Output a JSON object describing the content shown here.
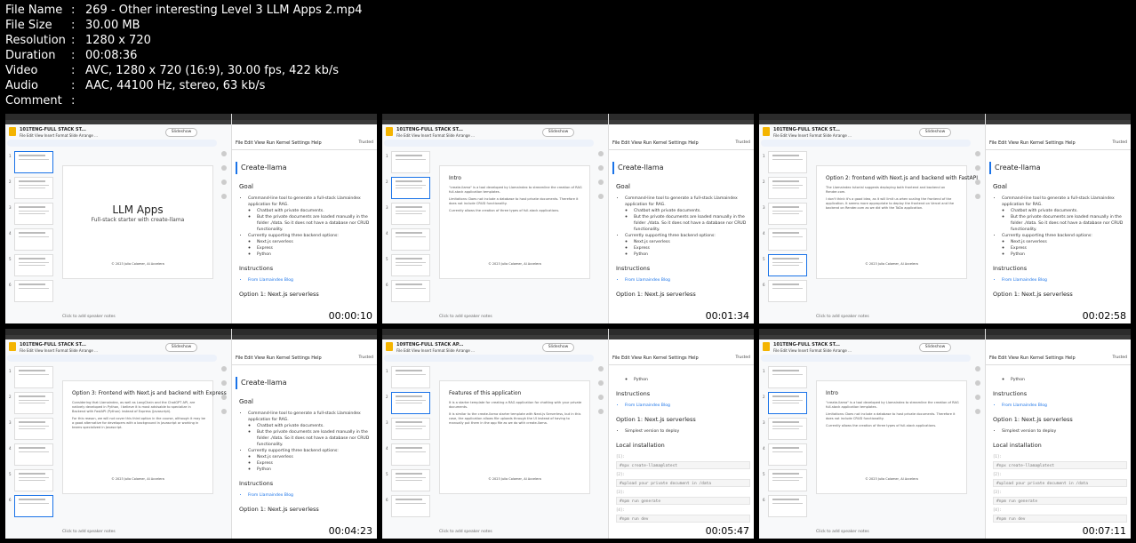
{
  "meta": [
    {
      "key": "File Name",
      "value": "269 - Other interesting Level 3 LLM Apps 2.mp4"
    },
    {
      "key": "File Size",
      "value": "30.00 MB"
    },
    {
      "key": "Resolution",
      "value": "1280 x 720"
    },
    {
      "key": "Duration",
      "value": "00:08:36"
    },
    {
      "key": "Video",
      "value": "AVC, 1280 x 720 (16:9), 30.00 fps, 422 kb/s"
    },
    {
      "key": "Audio",
      "value": "AAC, 44100 Hz, stereo, 63 kb/s"
    },
    {
      "key": "Comment",
      "value": ""
    }
  ],
  "separator": ":",
  "common": {
    "slides_menu": "File  Edit  View  Insert  Format  Slide  Arrange ...",
    "slideshow": "Slideshow",
    "notes": "Click to add speaker notes",
    "jup_menu": "File   Edit   View   Run   Kernel   Settings   Help",
    "trusted": "Trusted",
    "create_llama": "Create-llama",
    "goal": "Goal",
    "goal_text": "Command-line tool to generate a full-stack Llamaindex application for RAG.",
    "sub1": "Chatbot with private documents.",
    "sub2": "But the private documents are loaded manually in the folder ./data. So it does not have a database nor CRUD functionality.",
    "backends": "Currently supporting three backend options:",
    "b1": "Next.js serverless",
    "b2": "Express",
    "b3": "Python",
    "instructions": "Instructions",
    "from_blog": "From Llamaindex Blog",
    "option1": "Option 1: Next.js serverless",
    "simplest": "Simplest version to deploy",
    "local_install": "Local installation",
    "cmd1": "#npx create-llama@latest",
    "cmd2": "#upload your private document in /data",
    "cmd3": "#npm run generate",
    "cmd4": "#npm run dev",
    "prompt1": "[1]:",
    "prompt2": "[2]:",
    "prompt3": "[3]:",
    "prompt4": "[4]:",
    "copyright": "© 2023 Julio Colomer, AI Accelera"
  },
  "tiles": [
    {
      "doc_title": "101TENG-FULL STACK ST...",
      "slide_title": "LLM Apps",
      "slide_sub": "Full-stack starter with create-llama",
      "timestamp": "00:00:10"
    },
    {
      "doc_title": "101TENG-FULL STACK ST...",
      "slide_heading": "Intro",
      "slide_body": [
        "\"create-llama\" is a tool developed by Llamaindex to streamline the creation of RAG full-stack application templates.",
        "Limitations: Does not include a database to host private documents. Therefore it does not include CRUD functionality.",
        "Currently allows the creation of three types of full-stack applications."
      ],
      "timestamp": "00:01:34"
    },
    {
      "doc_title": "101TENG-FULL STACK ST...",
      "slide_heading": "Option 2: frontend with Next.js and backend with FastAPI",
      "slide_body": [
        "The Llamaindex tutorial suggests deploying both frontend and backend on Render.com.",
        "I don't think it's a good idea, as it will limit us when scaling the frontend of the application. It seems more appropriate to deploy the frontend on Vercel and the backend on Render.com as we did with the ToDo application."
      ],
      "timestamp": "00:02:58"
    },
    {
      "doc_title": "101TENG-FULL STACK ST...",
      "slide_heading": "Option 3: Frontend with Next.js and backend with Express",
      "slide_body": [
        "Considering that Llamaindex, as well as LangChain and the ChatGPT API, are natively developed in Python, I believe it is most advisable to specialize in Backend with FastAPI (Python) instead of Express (Javascript).",
        "For this reason, we will not cover this third option in the course, although it may be a good alternative for developers with a background in Javascript or working in teams specialized in Javascript."
      ],
      "timestamp": "00:04:23"
    },
    {
      "doc_title": "109TENG-FULL STACK AP...",
      "slide_heading": "Features of this application",
      "slide_body": [
        "It is a starter template for creating a RAG application for chatting with your private documents.",
        "It is similar to the create-llama starter template with Next.js Serverless, but in this case, the application allows file uploads through the UI instead of having to manually put them in the app file as we do with create-llama."
      ],
      "timestamp": "00:05:47"
    },
    {
      "doc_title": "101TENG-FULL STACK ST...",
      "slide_heading": "Intro",
      "slide_body": [
        "\"create-llama\" is a tool developed by Llamaindex to streamline the creation of RAG full-stack application templates.",
        "Limitations: Does not include a database to host private documents. Therefore it does not include CRUD functionality.",
        "Currently allows the creation of three types of full-stack applications."
      ],
      "timestamp": "00:07:11"
    }
  ]
}
